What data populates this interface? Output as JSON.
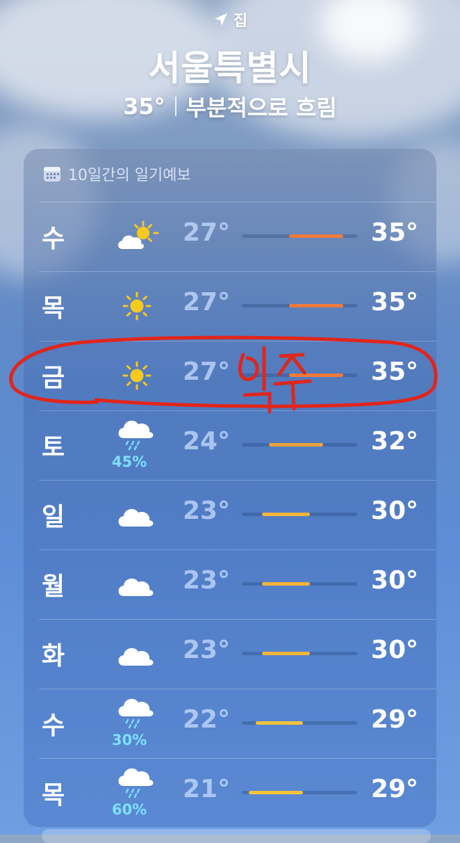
{
  "header": {
    "location_label": "집",
    "city": "서울특별시",
    "current_temp": "35°",
    "condition": "부분적으로 흐림"
  },
  "forecast": {
    "title": "10일간의 일기예보",
    "days": [
      {
        "day": "수",
        "icon": "partly-cloudy-icon",
        "precip": "",
        "low": "27°",
        "high": "35°",
        "low_value": 27,
        "high_value": 35,
        "bar_color": "#f07a3a"
      },
      {
        "day": "목",
        "icon": "sun-icon",
        "precip": "",
        "low": "27°",
        "high": "35°",
        "low_value": 27,
        "high_value": 35,
        "bar_color": "#f07a3a"
      },
      {
        "day": "금",
        "icon": "sun-icon",
        "precip": "",
        "low": "27°",
        "high": "35°",
        "low_value": 27,
        "high_value": 35,
        "bar_color": "#f07a3a"
      },
      {
        "day": "토",
        "icon": "rain-cloud-icon",
        "precip": "45%",
        "low": "24°",
        "high": "32°",
        "low_value": 24,
        "high_value": 32,
        "bar_color": "#f5a13a"
      },
      {
        "day": "일",
        "icon": "cloud-icon",
        "precip": "",
        "low": "23°",
        "high": "30°",
        "low_value": 23,
        "high_value": 30,
        "bar_color": "#f5b43a"
      },
      {
        "day": "월",
        "icon": "cloud-icon",
        "precip": "",
        "low": "23°",
        "high": "30°",
        "low_value": 23,
        "high_value": 30,
        "bar_color": "#f5b43a"
      },
      {
        "day": "화",
        "icon": "cloud-icon",
        "precip": "",
        "low": "23°",
        "high": "30°",
        "low_value": 23,
        "high_value": 30,
        "bar_color": "#f5b43a"
      },
      {
        "day": "수",
        "icon": "rain-cloud-icon",
        "precip": "30%",
        "low": "22°",
        "high": "29°",
        "low_value": 22,
        "high_value": 29,
        "bar_color": "#f5c23a"
      },
      {
        "day": "목",
        "icon": "rain-cloud-icon",
        "precip": "60%",
        "low": "21°",
        "high": "29°",
        "low_value": 21,
        "high_value": 29,
        "bar_color": "#f5c23a"
      }
    ],
    "range_min": 20,
    "range_max": 37
  },
  "annotation": {
    "text": "입추",
    "color": "#e0261c"
  }
}
